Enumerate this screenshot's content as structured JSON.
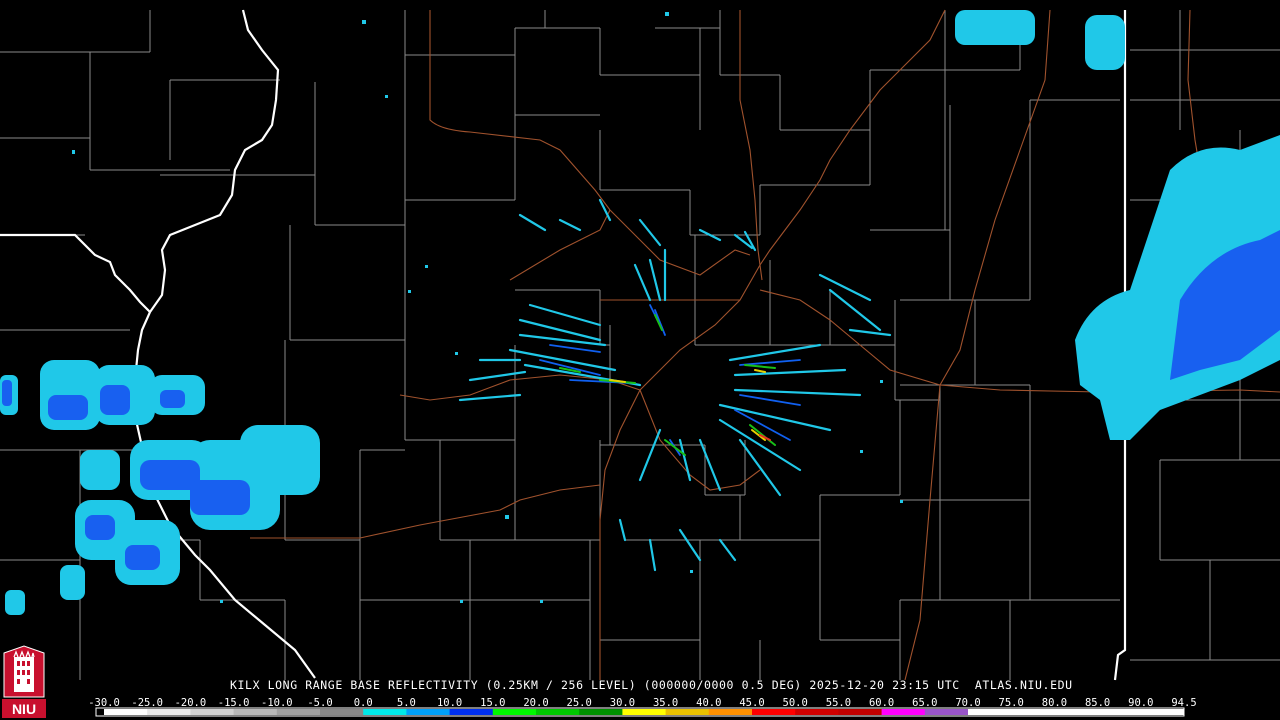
{
  "header": {
    "title": "KILX LONG RANGE BASE REFLECTIVITY (0.25KM / 256 LEVEL) (000000/0000 0.5 DEG) 2025-12-20 23:15 UTC  ATLAS.NIU.EDU"
  },
  "logo": {
    "text": "NIU",
    "icon": "niu-tower-logo"
  },
  "scale": {
    "labels": [
      "-30.0",
      "-25.0",
      "-20.0",
      "-15.0",
      "-10.0",
      "-5.0",
      "0.0",
      "5.0",
      "10.0",
      "15.0",
      "20.0",
      "25.0",
      "30.0",
      "35.0",
      "40.0",
      "45.0",
      "50.0",
      "55.0",
      "60.0",
      "65.0",
      "70.0",
      "75.0",
      "80.0",
      "85.0",
      "90.0",
      "94.5"
    ],
    "colors": [
      "#ffffff",
      "#e8e8e8",
      "#d0d0d0",
      "#b8b8b8",
      "#a0a0a0",
      "#888888",
      "#00e8e8",
      "#00a0f8",
      "#0030f0",
      "#00f800",
      "#00c800",
      "#009000",
      "#ffff00",
      "#e8c000",
      "#ff9000",
      "#ff0000",
      "#d00000",
      "#c00000",
      "#ff00ff",
      "#9955c9",
      "#ffffff",
      "#ffffff",
      "#ffffff",
      "#ffffff",
      "#ffffff"
    ]
  },
  "colors": {
    "state_border": "#ffffff",
    "county_border": "#8a8a8a",
    "highway": "#a0522d",
    "background": "#000000"
  }
}
